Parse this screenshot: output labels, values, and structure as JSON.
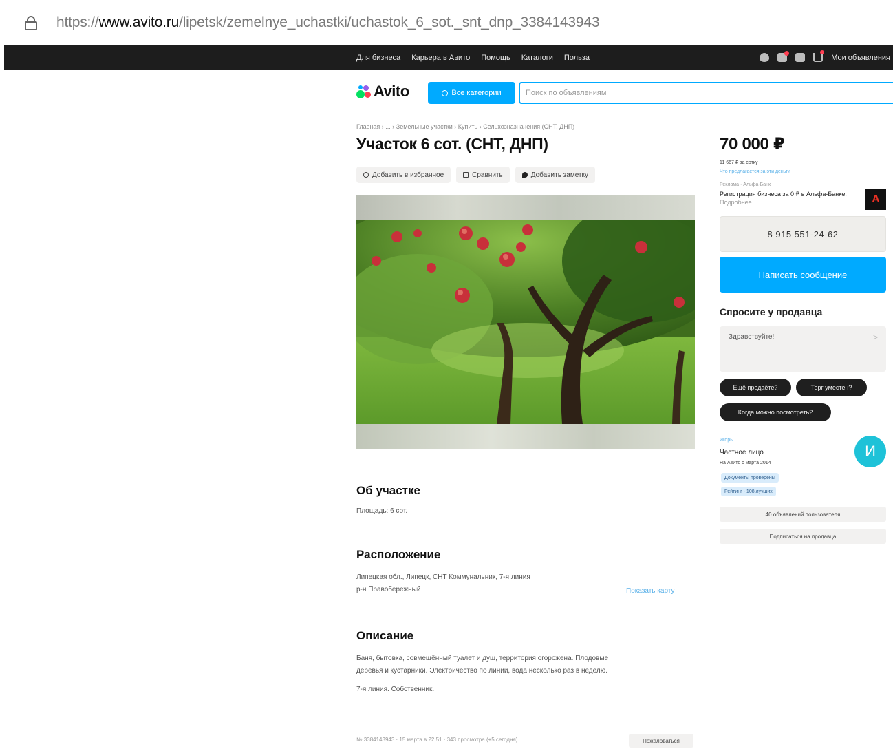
{
  "browser": {
    "url_prefix": "https://",
    "url_domain": "www.avito.ru",
    "url_path": "/lipetsk/zemelnye_uchastki/uchastok_6_sot._snt_dnp_3384143943"
  },
  "topnav": {
    "links": [
      "Для бизнеса",
      "Карьера в Авито",
      "Помощь",
      "Каталоги",
      "Польза"
    ],
    "my_ads": "Мои объявления"
  },
  "header": {
    "logo": "Avito",
    "categories_button": "Все категории",
    "search_placeholder": "Поиск по объявлениям"
  },
  "listing": {
    "breadcrumbs": "Главная › ... › Земельные участки › Купить › Сельхозназначения (СНТ, ДНП)",
    "title": "Участок 6 сот. (СНТ, ДНП)",
    "actions": {
      "favorite": "Добавить в избранное",
      "compare": "Сравнить",
      "note": "Добавить заметку"
    },
    "about": {
      "heading": "Об участке",
      "area": "Площадь: 6 сот."
    },
    "location": {
      "heading": "Расположение",
      "line1": "Липецкая обл., Липецк, СНТ Коммунальник, 7-я линия",
      "line2": "р-н Правобережный",
      "map_link": "Показать карту"
    },
    "description": {
      "heading": "Описание",
      "line1": "Баня, бытовка, совмещённый туалет и душ, территория огорожена. Плодовые",
      "line2": "деревья и кустарники. Электричество по линии, вода несколько раз в неделю.",
      "line3": "7-я линия. Собственник."
    },
    "footer": {
      "meta": "№ 3384143943 · 15 марта в 22:51 · 343 просмотра (+5 сегодня)",
      "report_button": "Пожаловаться"
    }
  },
  "sidebar": {
    "price": "70 000 ₽",
    "price_per": "11 667 ₽ за сотку",
    "price_link": "Что предлагается за эти деньги",
    "ad": {
      "label": "Реклама · Альфа-Банк",
      "text": "Регистрация бизнеса за 0 ₽ в Альфа-Банке.",
      "more": "Подробнее",
      "logo_letter": "А",
      "logo_color": "#ef3124"
    },
    "phone": "8 915 551-24-62",
    "message_button": "Написать сообщение",
    "ask": {
      "heading": "Спросите у продавца",
      "placeholder": "Здравствуйте!",
      "chips": [
        "Ещё продаёте?",
        "Торг уместен?",
        "Когда можно посмотреть?"
      ]
    },
    "seller": {
      "label": "Игорь",
      "type": "Частное лицо",
      "since": "На Авито с марта 2014",
      "badge_docs": "Документы проверены",
      "badge_rating": "Рейтинг · 108 лучших",
      "avatar_letter": "И",
      "avatar_color": "#1ec2d8"
    },
    "buttons": {
      "all_ads": "40 объявлений пользователя",
      "subscribe": "Подписаться на продавца"
    }
  },
  "colors": {
    "accent": "#00aaff",
    "topbar": "#1d1d1d"
  }
}
